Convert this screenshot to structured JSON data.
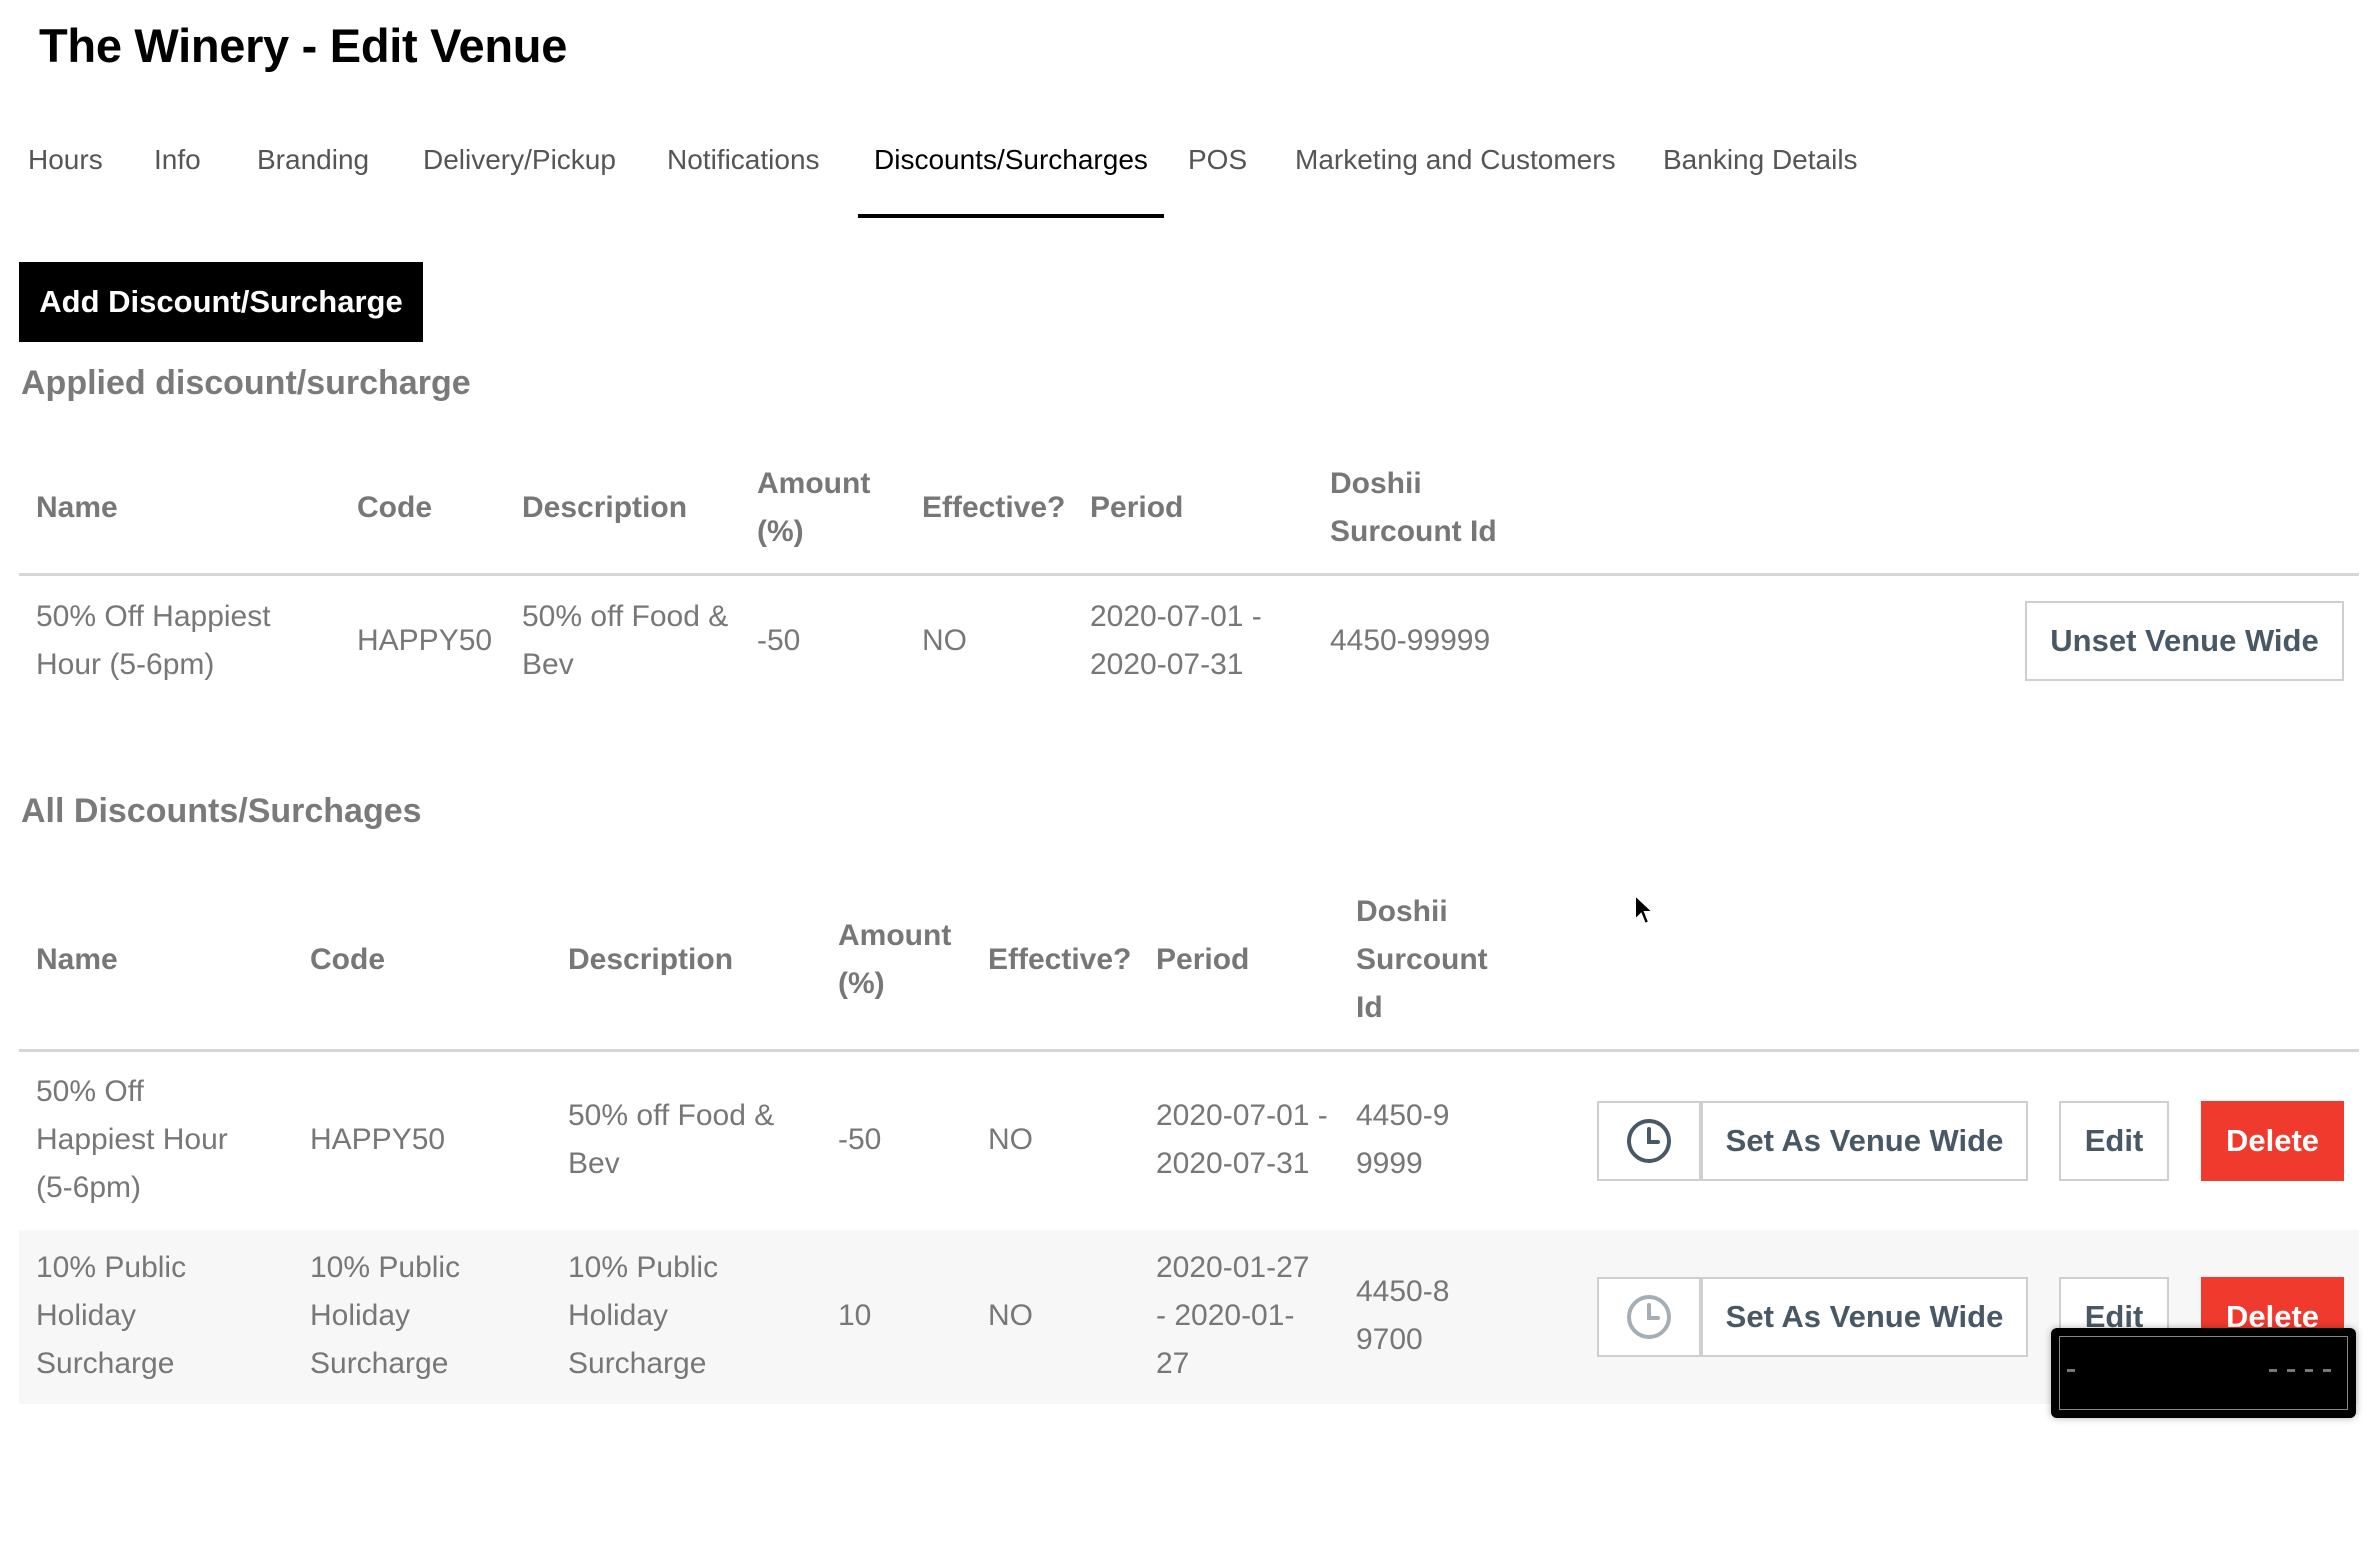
{
  "page": {
    "title": "The Winery - Edit Venue"
  },
  "tabs": [
    {
      "label": "Hours"
    },
    {
      "label": "Info"
    },
    {
      "label": "Branding"
    },
    {
      "label": "Delivery/Pickup"
    },
    {
      "label": "Notifications"
    },
    {
      "label": "Discounts/Surcharges",
      "active": true
    },
    {
      "label": "POS"
    },
    {
      "label": "Marketing and Customers"
    },
    {
      "label": "Banking Details"
    }
  ],
  "add_button": "Add Discount/Surcharge",
  "applied": {
    "title": "Applied discount/surcharge",
    "headers": [
      "Name",
      "Code",
      "Description",
      "Amount (%)",
      "Effective?",
      "Period",
      "Doshii Surcount Id"
    ],
    "rows": [
      {
        "name": "50% Off Happiest Hour (5-6pm)",
        "code": "HAPPY50",
        "description": "50% off Food & Bev",
        "amount": "-50",
        "effective": "NO",
        "period": "2020-07-01 - 2020-07-31",
        "doshii_id": "4450-99999",
        "action": "Unset Venue Wide"
      }
    ]
  },
  "all": {
    "title": "All Discounts/Surchages",
    "headers": [
      "Name",
      "Code",
      "Description",
      "Amount (%)",
      "Effective?",
      "Period",
      "Doshii Surcount Id"
    ],
    "rows": [
      {
        "name": "50% Off Happiest Hour (5-6pm)",
        "code": "HAPPY50",
        "description": "50% off Food & Bev",
        "amount": "-50",
        "effective": "NO",
        "period": "2020-07-01 - 2020-07-31",
        "doshii_id": "4450-99999",
        "set_label": "Set As Venue Wide",
        "edit_label": "Edit",
        "delete_label": "Delete"
      },
      {
        "name": "10% Public Holiday Surcharge",
        "code": "10% Public Holiday Surcharge",
        "description": "10% Public Holiday Surcharge",
        "amount": "10",
        "effective": "NO",
        "period": "2020-01-27 - 2020-01-27",
        "doshii_id": "4450-89700",
        "set_label": "Set As Venue Wide",
        "edit_label": "Edit",
        "delete_label": "Delete"
      }
    ]
  },
  "icons": {
    "clock": "clock-icon",
    "cursor": "mouse-pointer-icon"
  },
  "colors": {
    "delete": "#f03a2e",
    "primary": "#000000"
  }
}
